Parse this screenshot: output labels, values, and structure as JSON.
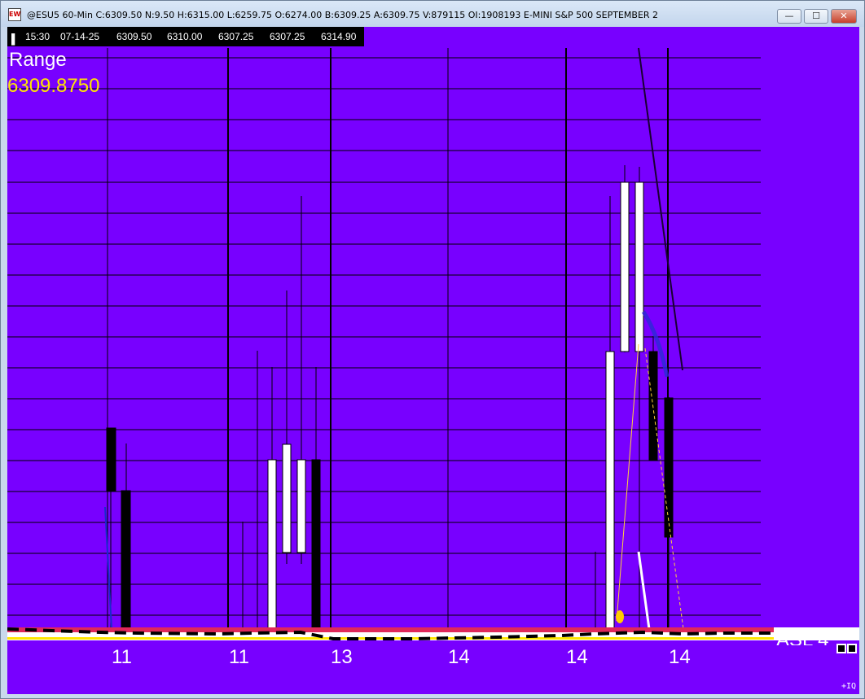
{
  "window": {
    "title": "@ESU5 60-Min C:6309.50 N:9.50 H:6315.00 L:6259.75 O:6274.00 B:6309.25 A:6309.75 V:879115 OI:1908193 E-MINI S&P 500 SEPTEMBER 2",
    "icon_text": "EW",
    "minimize_glyph": "—",
    "maximize_glyph": "☐",
    "close_glyph": "✕"
  },
  "data_box": {
    "marker": "▌",
    "time": "15:30",
    "date": "07-14-25",
    "v1": "6309.50",
    "v2": "6310.00",
    "v3": "6307.25",
    "v4": "6307.25",
    "v5": "6314.90"
  },
  "study": {
    "label": "Range",
    "value": "6309.8750"
  },
  "x_axis": {
    "labels": [
      "11",
      "11",
      "13",
      "14",
      "14",
      "14"
    ]
  },
  "lower_panel": {
    "label": "ASL 4"
  },
  "corner": {
    "tiq": "+IQ"
  },
  "colors": {
    "background": "#7800ff",
    "up_candle": "#ffffff",
    "down_candle": "#000000",
    "range_value": "#ffe600",
    "band_red": "#e0285a"
  }
}
